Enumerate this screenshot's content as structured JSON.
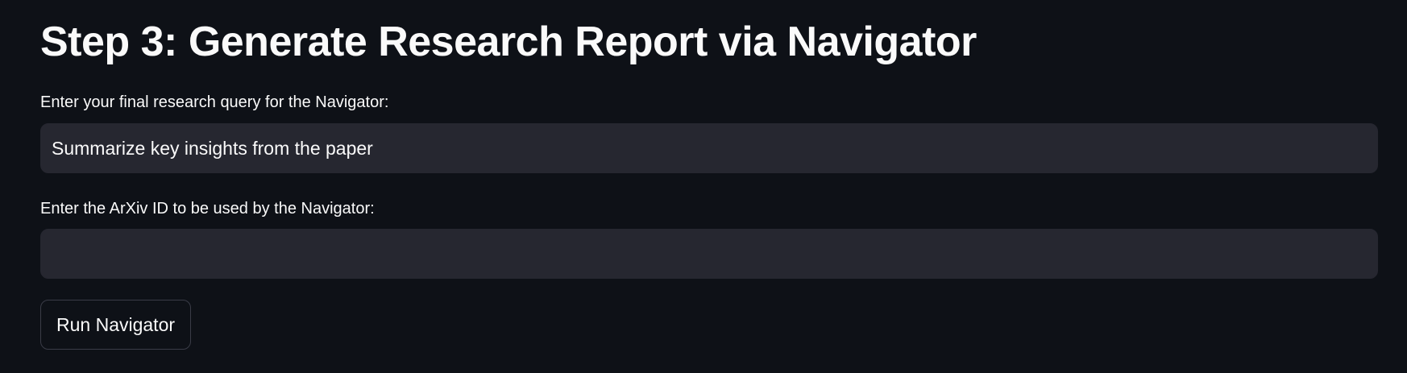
{
  "page": {
    "title": "Step 3: Generate Research Report via Navigator"
  },
  "query_field": {
    "label": "Enter your final research query for the Navigator:",
    "value": "Summarize key insights from the paper",
    "placeholder": ""
  },
  "arxiv_field": {
    "label": "Enter the ArXiv ID to be used by the Navigator:",
    "value": "",
    "placeholder": ""
  },
  "actions": {
    "run_label": "Run Navigator"
  },
  "colors": {
    "background": "#0e1117",
    "input_background": "#262730",
    "text": "#fafafa",
    "button_border": "#3a3c47"
  }
}
